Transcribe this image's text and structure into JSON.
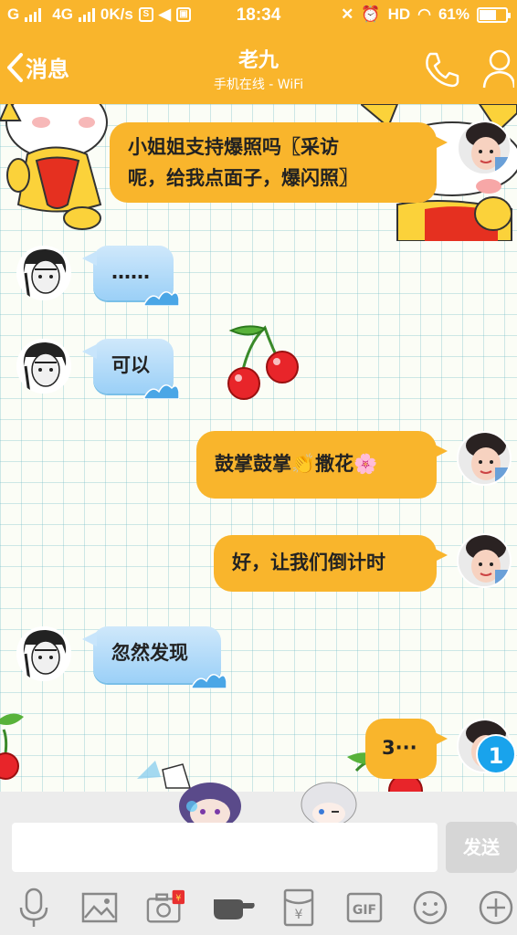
{
  "status_bar": {
    "network_left": "G",
    "network_4g": "4G",
    "speed": "0K/s",
    "time": "18:34",
    "hd": "HD",
    "battery": "61%"
  },
  "nav": {
    "back_label": "消息",
    "title": "老九",
    "subtitle": "手机在线 - WiFi"
  },
  "messages": [
    {
      "side": "out",
      "text_line1": "小姐姐支持爆照吗〖采访",
      "text_line2": "呢，给我点面子，爆闪照〗"
    },
    {
      "side": "in",
      "text": "……"
    },
    {
      "side": "in",
      "text": "可以"
    },
    {
      "side": "out",
      "text": "鼓掌鼓掌👏撒花🌸"
    },
    {
      "side": "out",
      "text": "好，让我们倒计时"
    },
    {
      "side": "in",
      "text": "忽然发现"
    },
    {
      "side": "out",
      "text": "3···"
    }
  ],
  "unread_badge": "1",
  "composer": {
    "placeholder": "",
    "send_label": "发送",
    "gif_label": "GIF",
    "redpacket_badge": "¥"
  },
  "icons": {
    "toolbar": [
      "microphone-icon",
      "image-icon",
      "camera-icon",
      "poke-icon",
      "red-packet-icon",
      "gif-icon",
      "emoji-icon",
      "plus-icon"
    ]
  },
  "colors": {
    "accent": "#f9b52c",
    "bubble_in": "#9bd0f7",
    "badge": "#19a3ec"
  }
}
